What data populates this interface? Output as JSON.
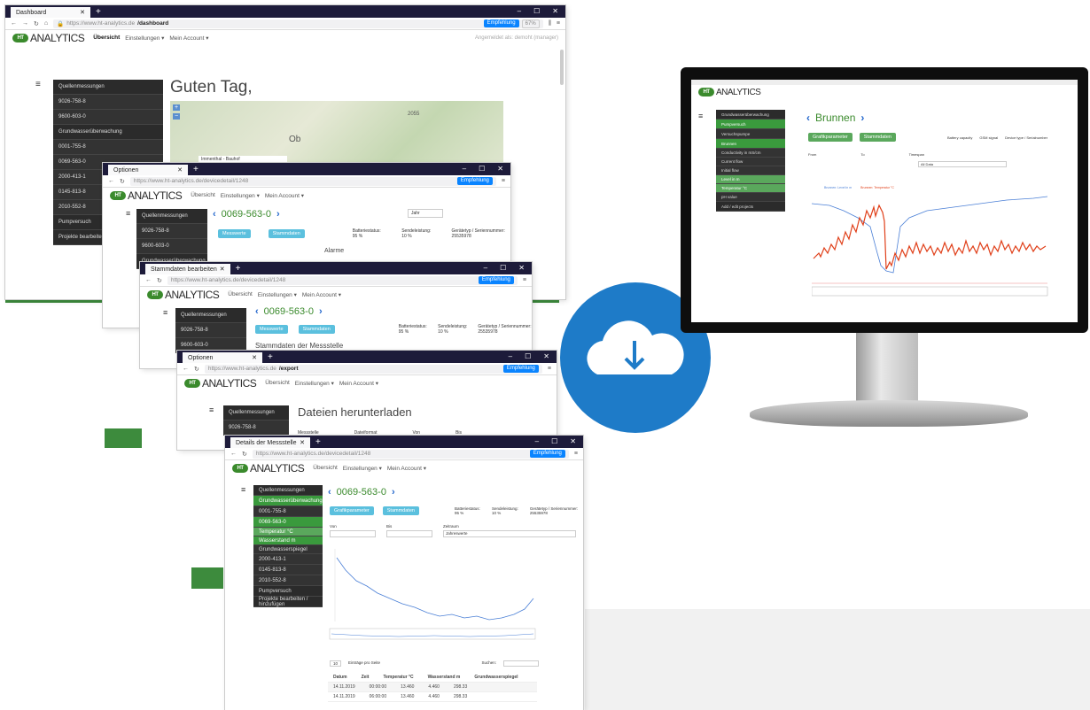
{
  "w1": {
    "tab": "Dashboard",
    "url_host": "https://www.ht-analytics.de",
    "url_path": "/dashboard",
    "empfehlung": "Empfehlung",
    "zoom": "67%",
    "greeting": "Guten Tag,",
    "map_label": "Immenthal - Bauhof",
    "map_place": "Ob",
    "map_num": "2055",
    "acct": "Angemeldet als: demoht (manager)",
    "side": [
      "Quellenmessungen",
      "9026-758-8",
      "9600-603-0",
      "Grundwasserüberwachung",
      "0001-755-8",
      "0069-563-0",
      "2000-413-1",
      "0145-813-8",
      "2010-552-8",
      "Pumpversuch",
      "Projekte bearbeiten"
    ]
  },
  "logo": {
    "mark": "HT",
    "text": "ANALYTICS"
  },
  "nav": {
    "main": "Übersicht",
    "settings": "Einstellungen ▾",
    "account": "Mein Account ▾"
  },
  "w2": {
    "tab": "Optionen",
    "url": "https://www.ht-analytics.de/devicedetail/1248",
    "title": "0069-563-0",
    "btn1": "Messwerte",
    "btn2": "Stammdaten",
    "battery": "Batteriestatus: 95 %",
    "signal": "Sendeleistung: 10 %",
    "device": "Gerätetyp / Seriennummer: 25535978",
    "section": "Alarme",
    "select": "Jahr"
  },
  "w3": {
    "tab": "Stammdaten bearbeiten",
    "url": "https://www.ht-analytics.de/devicedetail/1248",
    "title": "0069-563-0",
    "section": "Stammdaten der Messstelle"
  },
  "w4": {
    "tab": "Optionen",
    "url_host": "https://www.ht-analytics.de",
    "url_path": "/export",
    "title": "Dateien herunterladen",
    "cols": [
      "Messstelle",
      "Dateiformat",
      "Von",
      "Bis"
    ]
  },
  "w5": {
    "tab": "Details der Messstelle",
    "url": "https://www.ht-analytics.de/devicedetail/1248",
    "title": "0069-563-0",
    "btn1": "Grafikparameter",
    "btn2": "Stammdaten",
    "von": "Von",
    "bis": "Bis",
    "zeitraum": "Zeitraum",
    "zeitraum_val": "Jahreswerte",
    "search": "Suchen:",
    "entries": "Einträge pro Seite",
    "side": [
      "Quellenmessungen",
      "Grundwasserüberwachung",
      "0001-755-8",
      "0069-563-0",
      "Temperatur °C",
      "Wasserstand m",
      "Grundwasserspiegel",
      "2000-413-1",
      "0145-813-8",
      "2010-552-8",
      "Pumpversuch",
      "Projekte bearbeiten / hinzufügen"
    ],
    "table_head": [
      "Datum",
      "Zeit",
      "Temperatur °C",
      "Wasserstand m",
      "Grundwasserspiegel"
    ],
    "rows": [
      [
        "14.11.2019",
        "00:00:00",
        "13.460",
        "4.460",
        "298.33"
      ],
      [
        "14.11.2019",
        "06:00:00",
        "13.460",
        "4.460",
        "298.33"
      ]
    ]
  },
  "monitor": {
    "title": "Brunnen",
    "btn1": "Grafikparameter",
    "btn2": "Stammdaten",
    "battery": "Battery capacity",
    "signal": "GSM signal",
    "device": "Device type / Serialnumber",
    "device_val": "25535978",
    "from": "From",
    "to": "To",
    "timespan": "Timespan",
    "timespan_val": "All Data",
    "legend1": "Brunnen: Level in m",
    "legend2": "Brunnen: Temperatur °C",
    "side": [
      "Grundwasserüberwachung",
      "Pumpversuch",
      "Versuchspumpe",
      "Brunnen",
      "Conductivity in mS/cm",
      "Current flow",
      "Initial flow",
      "Level in m",
      "Temperatur °C",
      "pH value",
      "Add / edit projects"
    ]
  }
}
